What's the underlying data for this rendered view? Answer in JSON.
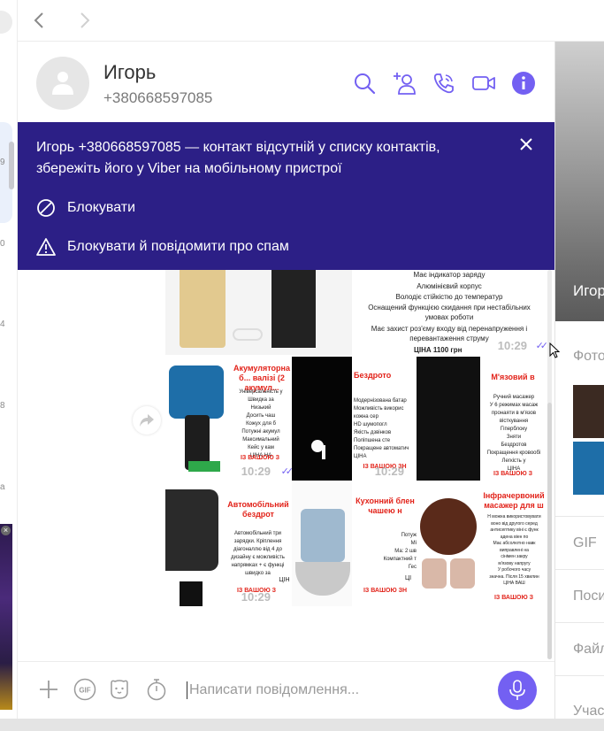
{
  "sidebar": {
    "numbers": [
      "9",
      "0",
      "4",
      "8",
      "a"
    ]
  },
  "contact": {
    "name": "Игорь",
    "phone": "+380668597085"
  },
  "banner": {
    "message": "Игорь +380668597085 — контакт відсутній у списку контактів, збережіть його у Viber на мобільному пристрої",
    "block_label": "Блокувати",
    "block_spam_label": "Блокувати й повідомити про спам"
  },
  "media": {
    "powerbank": {
      "lines": [
        "Має індикатор заряду",
        "Алюмінієвий корпус",
        "Володіє стійкістю до температур",
        "Оснащений функцією скидання при нестабільних умовах роботи",
        "Має захист роз'єму входу від перенапруження і перевантаження струму"
      ],
      "price": "ЦІНА 1100 грн",
      "time": "10:29"
    },
    "grinder": {
      "title": "Акумуляторна б... валізі (2 акумул...",
      "lines": [
        "Універсальність у",
        "Швидка за",
        "Низький",
        "Досить чаш",
        "Кожух для б",
        "Потужні акумул",
        "Максимальний",
        "Кейс у кам",
        "ЦІНА НА"
      ],
      "price": "ІЗ ВАШОЮ З",
      "time": "10:29"
    },
    "earbuds": {
      "title": "Бездрото",
      "lines": [
        "Модернізована батар",
        "Можливість викорис",
        "кожна сер",
        "HD шумопогл",
        "Якість дзвінков",
        "Поліпшена сте",
        "Покращене автоматич",
        "ЦІНА"
      ],
      "price": "ІЗ ВАШОЮ ЗН",
      "time": "10:29"
    },
    "massager_gun": {
      "title": "М'язовий в",
      "lines": [
        "Ручний масажер",
        "У 6 режимах масаж",
        "пронаяти в м'язов",
        "вісткування",
        "Гіперблоку",
        "Зняти",
        "Бездротов",
        "Покращення кровообі",
        "Легкість у",
        "ЦІНА"
      ],
      "price": "ІЗ ВАШОЮ З",
      "time": "10:29"
    },
    "car_charger": {
      "title": "Автомобільний бездрот",
      "lines": [
        "Автомобільний три",
        "зарядки. Кріплення",
        "діагоналлю від 4 до",
        "дизайну є можливість",
        "напрямках + є функці",
        "швидко за"
      ],
      "price": "ІЗ ВАШОЮ З",
      "extra": "ЦІН",
      "time": "10:29"
    },
    "blender": {
      "title": "Кухонний блен чашею н",
      "lines": [
        "Потуж",
        "Мі",
        "Ма: 2 шв",
        "Компактний т",
        "Гес"
      ],
      "price": "ІЗ ВАШОЮ ЗН",
      "extra": "ЦІ",
      "time": "10:29"
    },
    "massager_ir": {
      "title": "Інфрачервоний масажер для ш",
      "lines": [
        "Н можна використовувати",
        "воно від другого серед",
        "антисептику віні є функ",
        "адена віен по",
        "Має абсолютно навк",
        "виправлені на",
        "сінімен закру",
        "м'язову напругу",
        "У робочого часу",
        "значна. Після 15 хвилин",
        "ЦІНА ВАШ"
      ],
      "price": "ІЗ ВАШОЮ З",
      "time": "10:29"
    }
  },
  "composer": {
    "placeholder": "Написати повідомлення..."
  },
  "right_panel": {
    "name": "Игор",
    "photos_label": "Фото",
    "gif_label": "GIF",
    "links_label": "Поси",
    "files_label": "Файл",
    "members_label": "Учас"
  },
  "colors": {
    "accent": "#7360f2",
    "banner": "#2c1f86",
    "price_red": "#e2231a"
  }
}
